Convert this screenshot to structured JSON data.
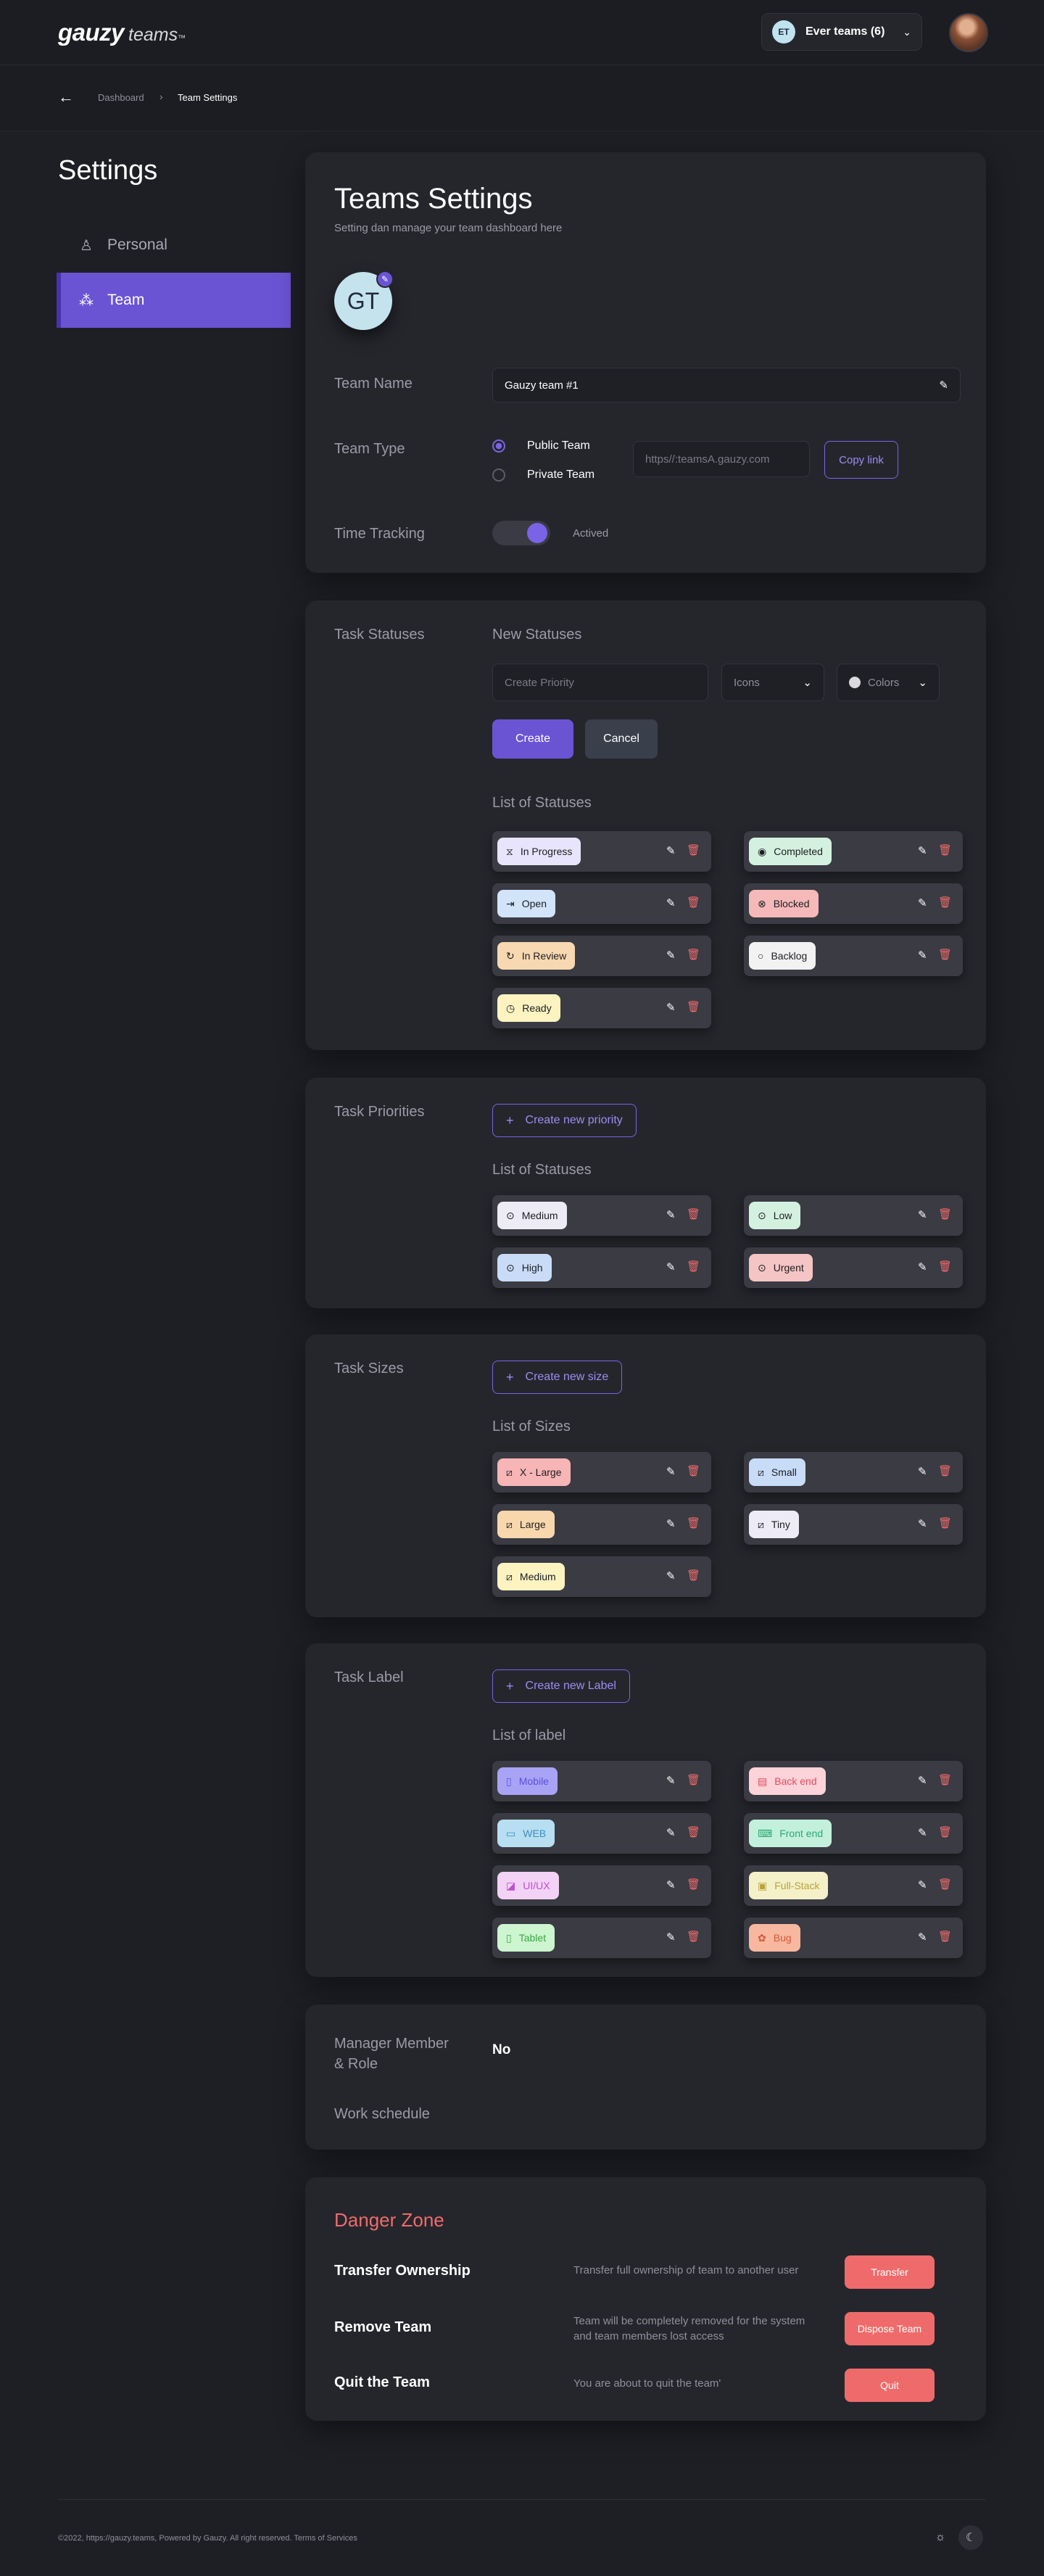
{
  "header": {
    "logo_main": "gauzy",
    "logo_sub": "teams",
    "logo_tm": "™",
    "team_initials": "ET",
    "team_label": "Ever teams (6)"
  },
  "breadcrumb": {
    "items": [
      "Dashboard",
      "Team Settings"
    ],
    "separator": "›",
    "back": "←"
  },
  "sidebar": {
    "title": "Settings",
    "items": [
      {
        "label": "Personal",
        "icon": "user-icon",
        "glyph": "♙"
      },
      {
        "label": "Team",
        "icon": "team-icon",
        "glyph": "⁂"
      }
    ]
  },
  "team_settings": {
    "title": "Teams Settings",
    "subtitle": "Setting dan manage your team dashboard here",
    "avatar_initials": "GT",
    "avatar_edit_glyph": "✎",
    "team_name_label": "Team Name",
    "team_name_value": "Gauzy team #1",
    "team_type_label": "Team Type",
    "public_label": "Public Team",
    "private_label": "Private Team",
    "link_placeholder": "https//:teamsA.gauzy.com",
    "copy_link": "Copy link",
    "time_tracking_label": "Time Tracking",
    "time_tracking_state": "Actived",
    "time_tracking_on": true
  },
  "task_statuses": {
    "section_label": "Task Statuses",
    "new_label": "New Statuses",
    "input_placeholder": "Create Priority",
    "icons_dropdown": "Icons",
    "colors_dropdown": "Colors",
    "create": "Create",
    "cancel": "Cancel",
    "list_label": "List of Statuses",
    "items": [
      {
        "label": "In Progress",
        "glyph": "⧖",
        "color": "#e8e4fb"
      },
      {
        "label": "Completed",
        "glyph": "◉",
        "color": "#d4f1df"
      },
      {
        "label": "Open",
        "glyph": "⇥",
        "color": "#d2e4fa"
      },
      {
        "label": "Blocked",
        "glyph": "⊗",
        "color": "#f5b9b9"
      },
      {
        "label": "In Review",
        "glyph": "↻",
        "color": "#f8d8b0"
      },
      {
        "label": "Backlog",
        "glyph": "○",
        "color": "#f2f2f2"
      },
      {
        "label": "Ready",
        "glyph": "◷",
        "color": "#fcf3c1"
      }
    ]
  },
  "task_priorities": {
    "section_label": "Task Priorities",
    "create": "Create new priority",
    "list_label": "List of Statuses",
    "items": [
      {
        "label": "Medium",
        "glyph": "⊙",
        "color": "#ecebf6"
      },
      {
        "label": "Low",
        "glyph": "⊙",
        "color": "#d4f1df"
      },
      {
        "label": "High",
        "glyph": "⊙",
        "color": "#c8dcf7"
      },
      {
        "label": "Urgent",
        "glyph": "⊙",
        "color": "#f5c4c4"
      }
    ]
  },
  "task_sizes": {
    "section_label": "Task Sizes",
    "create": "Create new size",
    "list_label": "List of Sizes",
    "items": [
      {
        "label": "X - Large",
        "glyph": "⧄",
        "color": "#f7b5b5"
      },
      {
        "label": "Small",
        "glyph": "⧄",
        "color": "#c8dcf7"
      },
      {
        "label": "Large",
        "glyph": "⧄",
        "color": "#f8d7ac"
      },
      {
        "label": "Tiny",
        "glyph": "⧄",
        "color": "#ecebf6"
      },
      {
        "label": "Medium",
        "glyph": "⧄",
        "color": "#fcf3c1"
      }
    ]
  },
  "task_label": {
    "section_label": "Task Label",
    "create": "Create new Label",
    "list_label": "List of  label",
    "items": [
      {
        "label": "Mobile",
        "glyph": "▯",
        "color": "#a9a3f5",
        "text": "#5a4fe0"
      },
      {
        "label": "Back end",
        "glyph": "▤",
        "color": "#fbd3d8",
        "text": "#e24a61"
      },
      {
        "label": "WEB",
        "glyph": "▭",
        "color": "#b8def1",
        "text": "#3a8fbd"
      },
      {
        "label": "Front end",
        "glyph": "⌨",
        "color": "#c3f0dc",
        "text": "#2aa873"
      },
      {
        "label": "UI/UX",
        "glyph": "◪",
        "color": "#f2d2f5",
        "text": "#c04fd0"
      },
      {
        "label": "Full-Stack",
        "glyph": "▣",
        "color": "#f4f0c8",
        "text": "#b8a43a"
      },
      {
        "label": "Tablet",
        "glyph": "▯",
        "color": "#cdf5cf",
        "text": "#3aa845"
      },
      {
        "label": "Bug",
        "glyph": "✿",
        "color": "#f8b89f",
        "text": "#d2573a"
      }
    ]
  },
  "manager": {
    "label_line1": "Manager Member",
    "label_line2": "& Role",
    "value": "No",
    "work_schedule": "Work schedule"
  },
  "danger_zone": {
    "title": "Danger Zone",
    "rows": [
      {
        "title": "Transfer Ownership",
        "desc": "Transfer full ownership of team to another user",
        "button": "Transfer"
      },
      {
        "title": "Remove Team",
        "desc": "Team will be completely removed for the system and team members lost access",
        "button": "Dispose Team"
      },
      {
        "title": "Quit the Team",
        "desc": "You are about to quit the team'",
        "button": "Quit"
      }
    ]
  },
  "footer": {
    "text": "©2022, https://gauzy.teams, Powered by Gauzy. All right reserved. Terms of Services",
    "light_glyph": "☼",
    "dark_glyph": "☾"
  },
  "colors": {
    "accent": "#6b54d4",
    "danger": "#ef6b6b",
    "background": "#1e1f25",
    "card": "#25262c"
  }
}
